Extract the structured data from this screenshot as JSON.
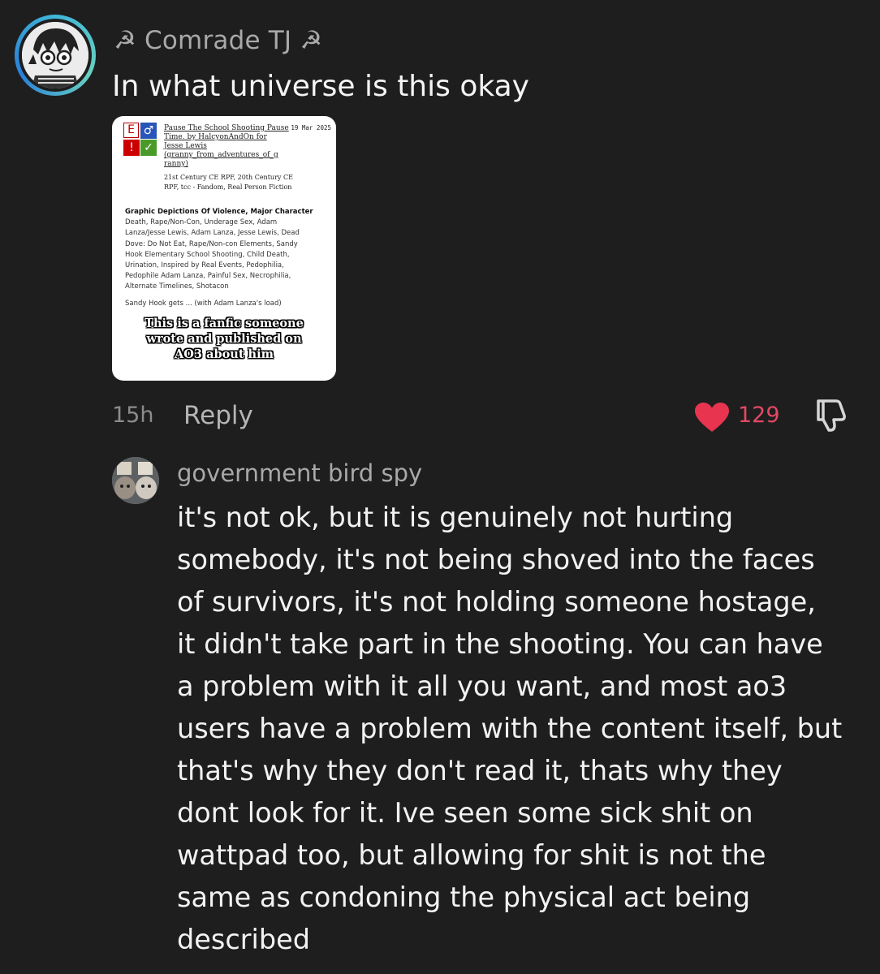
{
  "comment": {
    "username": "☭ Comrade TJ ☭",
    "text": "In what universe is this okay",
    "time": "15h",
    "reply_label": "Reply",
    "like_count": "129",
    "accent_color": "#e34864"
  },
  "attachment": {
    "work_title_lines": [
      "Pause The School Shooting Pause",
      "Time. by HalcyonAndOn for",
      "Jesse Lewis",
      "(granny_from_adventures_of_g",
      "ranny)"
    ],
    "date": "19 Mar 2025",
    "fandoms": "21st Century CE RPF, 20th Century CE RPF, tcc - Fandom, Real Person Fiction",
    "tags": [
      "Graphic Depictions Of Violence, Major Character",
      "Death, Rape/Non-Con, Underage Sex, Adam",
      "Lanza/Jesse Lewis, Adam Lanza, Jesse Lewis, Dead",
      "Dove: Do Not Eat, Rape/Non-con Elements, Sandy",
      "Hook Elementary School Shooting, Child Death,",
      "Urination, Inspired by Real Events, Pedophilia,",
      "Pedophile Adam Lanza, Painful Sex, Necrophilia,",
      "Alternate Timelines, Shotacon"
    ],
    "summary": "Sandy Hook gets ... (with Adam Lanza's load)",
    "caption": "This is a fanfic someone wrote and published on AO3 about him"
  },
  "reply": {
    "username": "government bird spy",
    "lines": [
      "it's not ok, but it is genuinely not hurting",
      "somebody, it's not being shoved into the faces",
      "of survivors, it's not holding someone hostage,",
      "it didn't take part in the shooting. You can have",
      "a problem with it all you want, and most ao3",
      "users have a problem with the content itself, but",
      "that's why they don't read it, thats why they",
      "dont look for it. Ive seen some sick shit on",
      "wattpad too, but allowing for shit is not the",
      "same as condoning the physical act being",
      "described"
    ]
  },
  "icons": {
    "avatar": "user-avatar",
    "like": "heart-icon",
    "dislike": "thumbs-down-icon",
    "reply_avatar": "cats-avatar"
  }
}
